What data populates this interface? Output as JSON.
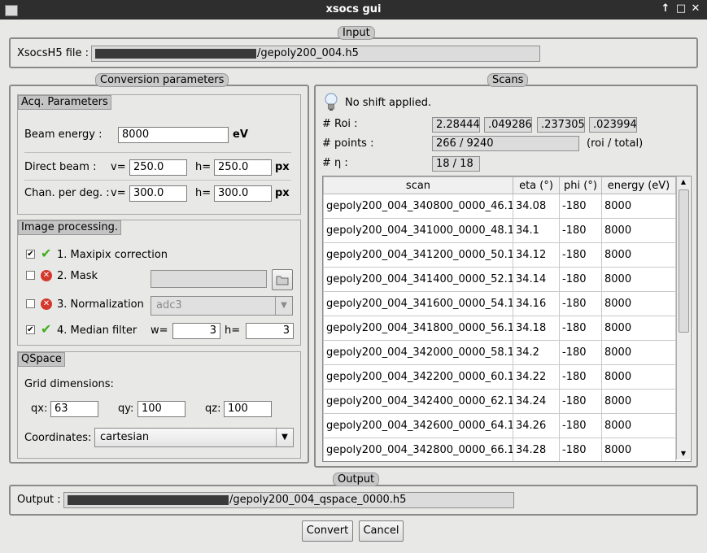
{
  "window": {
    "title": "xsocs gui",
    "controls": [
      "↑",
      "□",
      "✕"
    ]
  },
  "input": {
    "group_label": "Input",
    "file_label": "XsocsH5 file :",
    "file_suffix": "/gepoly200_004.h5"
  },
  "conversion": {
    "group_label": "Conversion parameters",
    "acq": {
      "label": "Acq. Parameters",
      "beam_energy_label": "Beam energy :",
      "beam_energy_value": "8000",
      "beam_energy_unit": "eV",
      "direct_beam_label": "Direct beam :",
      "v_label": "v=",
      "h_label": "h=",
      "direct_beam_v": "250.0",
      "direct_beam_h": "250.0",
      "px_unit": "px",
      "chan_label": "Chan. per deg. :",
      "chan_v_label": "v=",
      "chan_v": "300.0",
      "chan_h_label": "h=",
      "chan_h": "300.0",
      "chan_unit": "px"
    },
    "imgproc": {
      "label": "Image processing.",
      "maxipix_label": "1. Maxipix correction",
      "maxipix_checked": true,
      "mask_label": "2. Mask",
      "mask_checked": false,
      "norm_label": "3. Normalization",
      "norm_checked": false,
      "norm_value": "adc3",
      "median_label": "4. Median filter",
      "median_checked": true,
      "median_w_label": "w=",
      "median_w": "3",
      "median_h_label": "h=",
      "median_h": "3"
    },
    "qspace": {
      "label": "QSpace",
      "grid_label": "Grid dimensions:",
      "qx_label": "qx:",
      "qx": "63",
      "qy_label": "qy:",
      "qy": "100",
      "qz_label": "qz:",
      "qz": "100",
      "coord_label": "Coordinates:",
      "coord_value": "cartesian"
    }
  },
  "scans": {
    "group_label": "Scans",
    "shift_text": "No shift applied.",
    "roi_label": "# Roi :",
    "roi_values": [
      "2.28444",
      ".049286",
      ".237305",
      ".023994"
    ],
    "points_label": "# points :",
    "points_value": "266 / 9240",
    "points_note": "(roi / total)",
    "eta_label": "# η :",
    "eta_value": "18 / 18",
    "columns": [
      "scan",
      "eta (°)",
      "phi (°)",
      "energy (eV)"
    ],
    "rows": [
      [
        "gepoly200_004_340800_0000_46.1",
        "34.08",
        "-180",
        "8000"
      ],
      [
        "gepoly200_004_341000_0000_48.1",
        "34.1",
        "-180",
        "8000"
      ],
      [
        "gepoly200_004_341200_0000_50.1",
        "34.12",
        "-180",
        "8000"
      ],
      [
        "gepoly200_004_341400_0000_52.1",
        "34.14",
        "-180",
        "8000"
      ],
      [
        "gepoly200_004_341600_0000_54.1",
        "34.16",
        "-180",
        "8000"
      ],
      [
        "gepoly200_004_341800_0000_56.1",
        "34.18",
        "-180",
        "8000"
      ],
      [
        "gepoly200_004_342000_0000_58.1",
        "34.2",
        "-180",
        "8000"
      ],
      [
        "gepoly200_004_342200_0000_60.1",
        "34.22",
        "-180",
        "8000"
      ],
      [
        "gepoly200_004_342400_0000_62.1",
        "34.24",
        "-180",
        "8000"
      ],
      [
        "gepoly200_004_342600_0000_64.1",
        "34.26",
        "-180",
        "8000"
      ],
      [
        "gepoly200_004_342800_0000_66.1",
        "34.28",
        "-180",
        "8000"
      ]
    ]
  },
  "output": {
    "group_label": "Output",
    "file_label": "Output :",
    "file_suffix": "/gepoly200_004_qspace_0000.h5"
  },
  "buttons": {
    "convert": "Convert",
    "cancel": "Cancel"
  }
}
